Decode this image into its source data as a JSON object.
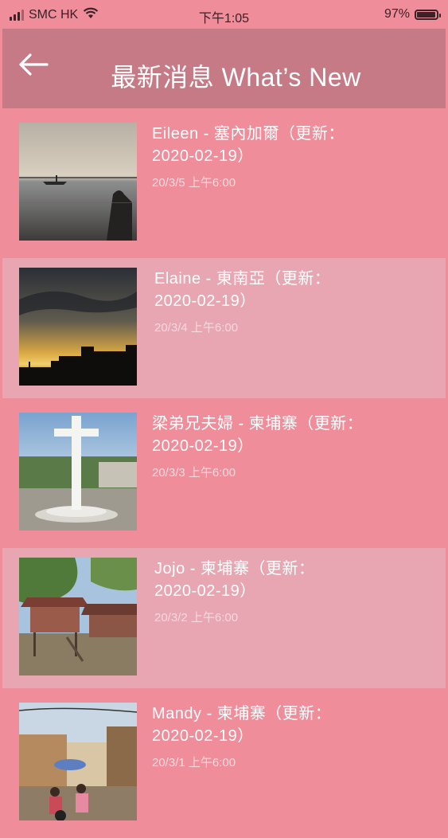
{
  "status": {
    "carrier": "SMC HK",
    "time": "下午1:05",
    "battery": "97%",
    "battery_level": 0.97
  },
  "header": {
    "title": "最新消息 What’s New"
  },
  "items": [
    {
      "title_line1": "Eileen - 塞內加爾（更新：",
      "title_line2": "2020-02-19）",
      "date": "20/3/5 上午6:00",
      "thumb_icon": "sunset-sea-photo"
    },
    {
      "title_line1": "Elaine - 東南亞（更新：",
      "title_line2": "2020-02-19）",
      "date": "20/3/4 上午6:00",
      "thumb_icon": "sunset-sky-photo"
    },
    {
      "title_line1": "梁弟兄夫婦 - 柬埔寨（更新：",
      "title_line2": "2020-02-19）",
      "date": "20/3/3 上午6:00",
      "thumb_icon": "cross-monument-photo"
    },
    {
      "title_line1": "Jojo - 柬埔寨（更新：",
      "title_line2": "2020-02-19）",
      "date": "20/3/2 上午6:00",
      "thumb_icon": "stilt-house-photo"
    },
    {
      "title_line1": "Mandy - 柬埔寨（更新：",
      "title_line2": "2020-02-19）",
      "date": "20/3/1 上午6:00",
      "thumb_icon": "street-market-photo"
    }
  ],
  "colors": {
    "background": "#ef8d9b",
    "header": "#c67a86",
    "alt_row": "#e7a6b2"
  }
}
